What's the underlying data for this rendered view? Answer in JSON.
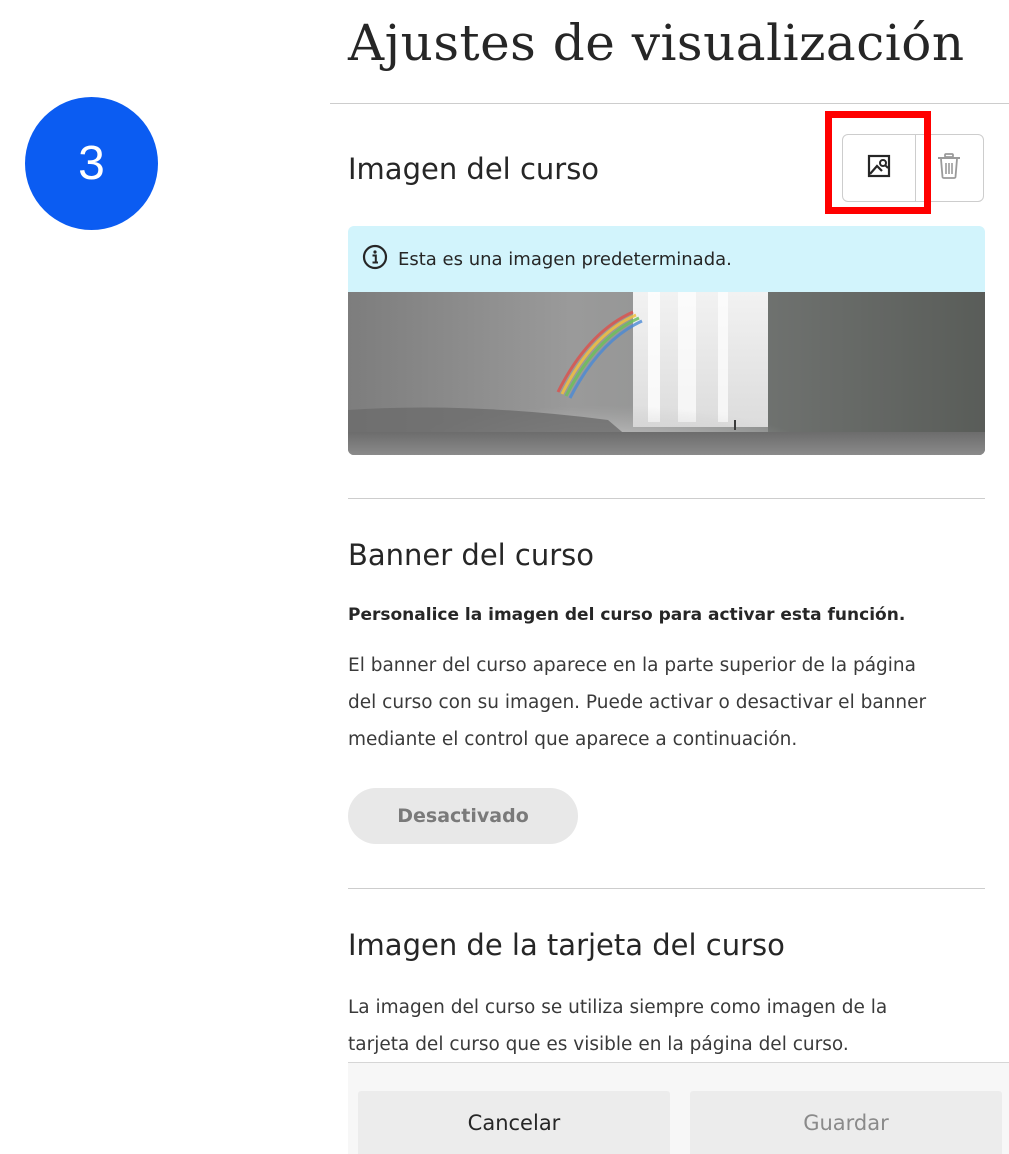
{
  "step_badge": {
    "number": "3",
    "color": "#0b5cf2"
  },
  "page": {
    "title": "Ajustes de visualización"
  },
  "course_image": {
    "heading": "Imagen del curso",
    "edit_icon": "image-edit-icon",
    "delete_icon": "trash-icon",
    "info_icon": "info-icon",
    "info_text": "Esta es una imagen predeterminada.",
    "image": "waterfall-with-rainbow",
    "highlight_color": "#ff0000"
  },
  "banner": {
    "heading": "Banner del curso",
    "note": "Personalice la imagen del curso para activar esta función.",
    "description_lines": [
      "El banner del curso aparece en la parte superior de la página",
      "del curso con su imagen. Puede activar o desactivar el banner",
      "mediante el control que aparece a continuación."
    ],
    "toggle_label": "Desactivado"
  },
  "card_image": {
    "heading": "Imagen de la tarjeta del curso",
    "description_lines": [
      "La imagen del curso se utiliza siempre como imagen de la",
      "tarjeta del curso que es visible en la página del curso."
    ]
  },
  "footer": {
    "cancel_label": "Cancelar",
    "save_label": "Guardar"
  }
}
